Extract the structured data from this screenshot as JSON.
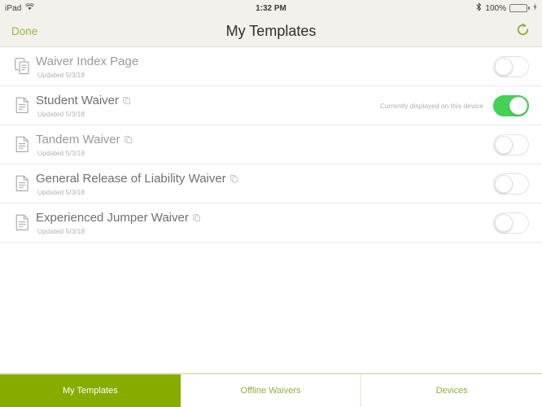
{
  "status_bar": {
    "device": "iPad",
    "wifi_icon": "wifi-icon",
    "time": "1:32 PM",
    "bluetooth_icon": "bluetooth-icon",
    "battery_percent": "100%",
    "battery_level": 100,
    "charging": true,
    "battery_color": "#4ccf4c"
  },
  "nav": {
    "done_label": "Done",
    "title": "My Templates",
    "refresh_icon": "refresh-icon",
    "accent_color": "#9cb63f",
    "background": "#f2f1ec"
  },
  "list": {
    "rows": [
      {
        "title": "Waiver Index Page",
        "subtitle": "Updated 5/3/18",
        "icon": "documents-copy-icon",
        "has_tag_icon": false,
        "note": "",
        "toggle_on": false,
        "dim_title": true
      },
      {
        "title": "Student Waiver",
        "subtitle": "Updated 5/3/18",
        "icon": "document-icon",
        "has_tag_icon": true,
        "note": "Currently displayed on this device",
        "toggle_on": true,
        "dim_title": false
      },
      {
        "title": "Tandem Waiver",
        "subtitle": "Updated 5/3/18",
        "icon": "document-icon",
        "has_tag_icon": true,
        "note": "",
        "toggle_on": false,
        "dim_title": true
      },
      {
        "title": "General Release of Liability Waiver",
        "subtitle": "Updated 5/3/18",
        "icon": "document-icon",
        "has_tag_icon": true,
        "note": "",
        "toggle_on": false,
        "dim_title": false
      },
      {
        "title": "Experienced Jumper Waiver",
        "subtitle": "Updated 5/3/18",
        "icon": "document-icon",
        "has_tag_icon": true,
        "note": "",
        "toggle_on": false,
        "dim_title": false
      }
    ]
  },
  "tabs": {
    "active_index": 0,
    "active_color": "#85ad00",
    "inactive_color": "#93ad3c",
    "items": [
      {
        "label": "My Templates"
      },
      {
        "label": "Offline Waivers"
      },
      {
        "label": "Devices"
      }
    ]
  }
}
